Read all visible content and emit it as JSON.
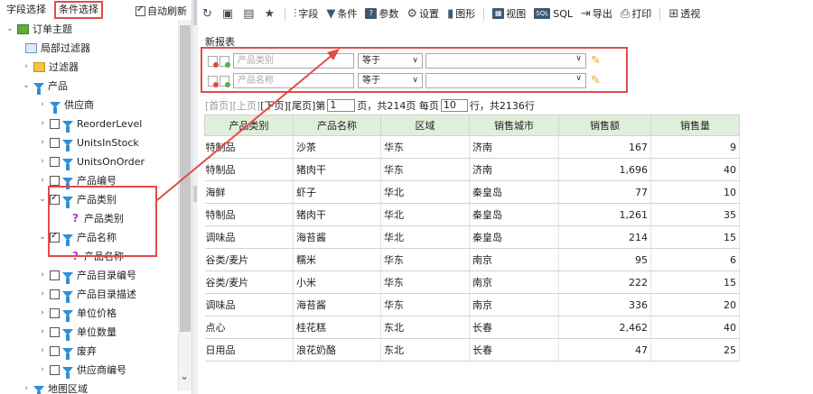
{
  "left": {
    "tab_fields": "字段选择",
    "tab_conditions": "条件选择",
    "auto_refresh": "自动刷新",
    "tree": [
      {
        "label": "订单主题",
        "icon": "topic-icon",
        "arrow": "⌄",
        "check": false,
        "indent": 6
      },
      {
        "label": "局部过滤器",
        "icon": "local-filter-icon",
        "arrow": "",
        "check": false,
        "indent": 28
      },
      {
        "label": "过滤器",
        "icon": "filter-folder-icon",
        "arrow": "›",
        "check": false,
        "indent": 24
      },
      {
        "label": "产品",
        "icon": "funnel-icon",
        "arrow": "⌄",
        "check": false,
        "indent": 24
      },
      {
        "label": "供应商",
        "icon": "funnel-icon",
        "arrow": "›",
        "check": false,
        "indent": 42
      },
      {
        "label": "ReorderLevel",
        "icon": "funnel-icon",
        "arrow": "›",
        "check": "off",
        "indent": 42
      },
      {
        "label": "UnitsInStock",
        "icon": "funnel-icon",
        "arrow": "›",
        "check": "off",
        "indent": 42
      },
      {
        "label": "UnitsOnOrder",
        "icon": "funnel-icon",
        "arrow": "›",
        "check": "off",
        "indent": 42
      },
      {
        "label": "产品编号",
        "icon": "funnel-icon",
        "arrow": "›",
        "check": "off",
        "indent": 42
      },
      {
        "label": "产品类别",
        "icon": "funnel-icon",
        "arrow": "⌄",
        "check": "on",
        "indent": 42
      },
      {
        "label": "产品类别",
        "icon": "question-icon",
        "arrow": "",
        "check": false,
        "indent": 80
      },
      {
        "label": "产品名称",
        "icon": "funnel-icon",
        "arrow": "⌄",
        "check": "on",
        "indent": 42
      },
      {
        "label": "产品名称",
        "icon": "question-icon",
        "arrow": "",
        "check": false,
        "indent": 80
      },
      {
        "label": "产品目录编号",
        "icon": "funnel-icon",
        "arrow": "›",
        "check": "off",
        "indent": 42
      },
      {
        "label": "产品目录描述",
        "icon": "funnel-icon",
        "arrow": "›",
        "check": "off",
        "indent": 42
      },
      {
        "label": "单位价格",
        "icon": "funnel-icon",
        "arrow": "›",
        "check": "off",
        "indent": 42
      },
      {
        "label": "单位数量",
        "icon": "funnel-icon",
        "arrow": "›",
        "check": "off",
        "indent": 42
      },
      {
        "label": "废弃",
        "icon": "funnel-icon",
        "arrow": "›",
        "check": "off",
        "indent": 42
      },
      {
        "label": "供应商编号",
        "icon": "funnel-icon",
        "arrow": "›",
        "check": "off",
        "indent": 42
      },
      {
        "label": "地图区域",
        "icon": "funnel-icon",
        "arrow": "›",
        "check": false,
        "indent": 24
      }
    ]
  },
  "toolbar": {
    "field": "字段",
    "condition": "条件",
    "param": "参数",
    "settings": "设置",
    "chart": "图形",
    "view": "视图",
    "sql": "SQL",
    "export": "导出",
    "print": "打印",
    "pivot": "透视"
  },
  "report": {
    "title": "新报表",
    "conditions": [
      {
        "field_placeholder": "产品类别",
        "operator": "等于"
      },
      {
        "field_placeholder": "产品名称",
        "operator": "等于"
      }
    ],
    "pager": {
      "first": "[首页]",
      "prev": "[上页]",
      "next": "[下页]",
      "last": "[尾页]",
      "page_prefix": " 第",
      "page_value": "1",
      "mid": "页，共214页 每页",
      "per_page": "10",
      "suffix": "行，共2136行"
    },
    "columns": [
      "产品类别",
      "产品名称",
      "区域",
      "销售城市",
      "销售额",
      "销售量"
    ],
    "rows": [
      [
        "特制品",
        "沙茶",
        "华东",
        "济南",
        "167",
        "9"
      ],
      [
        "特制品",
        "猪肉干",
        "华东",
        "济南",
        "1,696",
        "40"
      ],
      [
        "海鲜",
        "虾子",
        "华北",
        "秦皇岛",
        "77",
        "10"
      ],
      [
        "特制品",
        "猪肉干",
        "华北",
        "秦皇岛",
        "1,261",
        "35"
      ],
      [
        "调味品",
        "海苔酱",
        "华北",
        "秦皇岛",
        "214",
        "15"
      ],
      [
        "谷类/麦片",
        "糯米",
        "华东",
        "南京",
        "95",
        "6"
      ],
      [
        "谷类/麦片",
        "小米",
        "华东",
        "南京",
        "222",
        "15"
      ],
      [
        "调味品",
        "海苔酱",
        "华东",
        "南京",
        "336",
        "20"
      ],
      [
        "点心",
        "桂花糕",
        "东北",
        "长春",
        "2,462",
        "40"
      ],
      [
        "日用品",
        "浪花奶酪",
        "东北",
        "长春",
        "47",
        "25"
      ]
    ]
  },
  "colors": {
    "highlight": "#e24b48",
    "funnel": "#2f8fd8",
    "header_bg": "#dfefdb"
  }
}
